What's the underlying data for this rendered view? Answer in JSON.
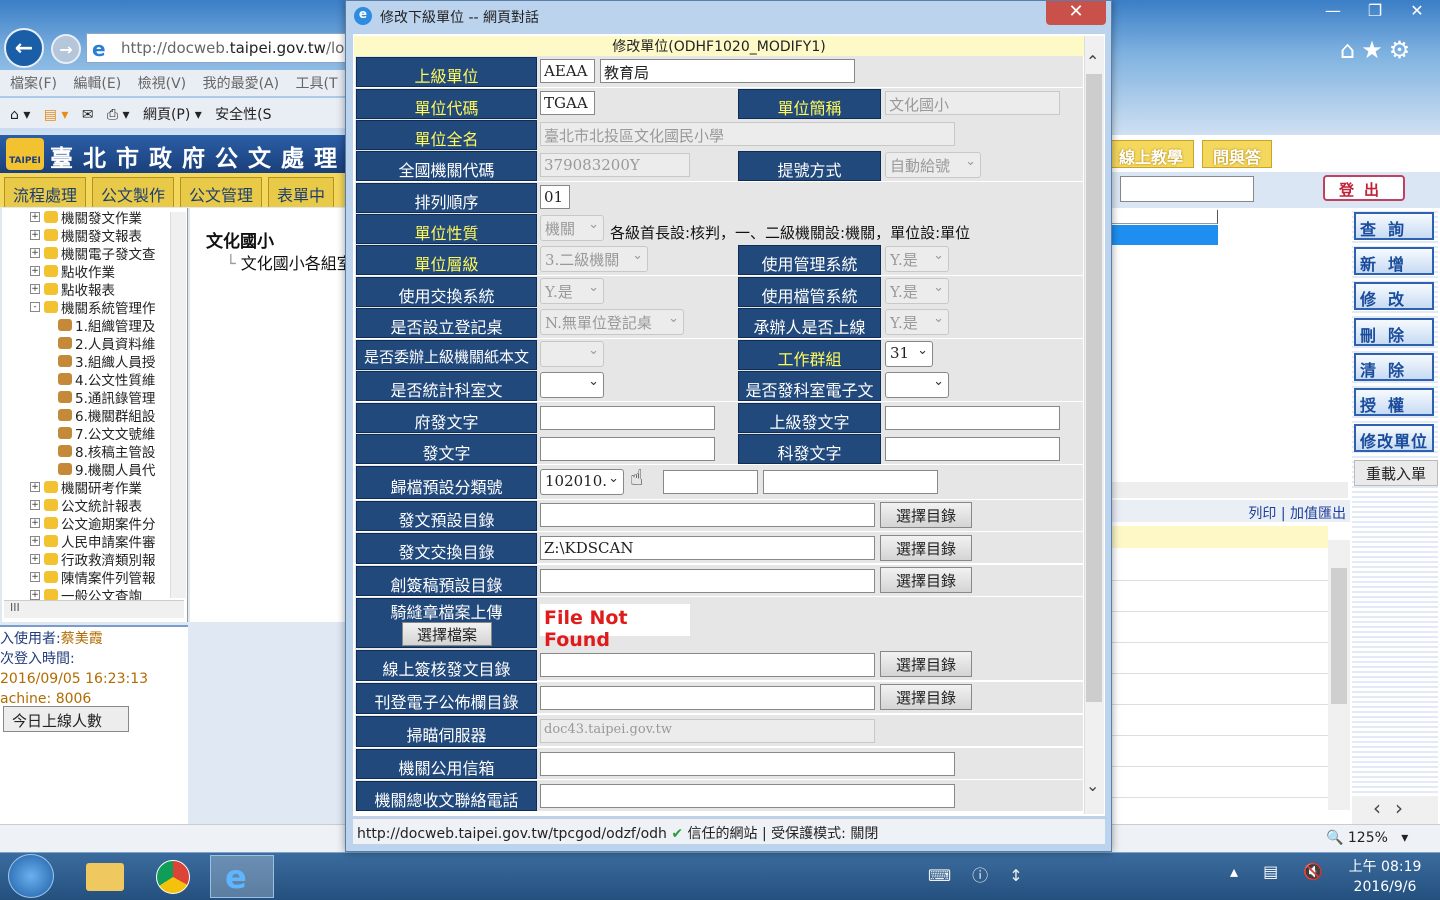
{
  "browser": {
    "url": "http://docweb.taipei.gov.tw/logi",
    "url_prefix": "http://docweb.",
    "url_domain": "taipei.gov.tw",
    "url_suffix": "/logi",
    "menu": "檔案(F) 編輯(E) 檢視(V) 我的最愛(A) 工具(T",
    "cmd_page": "網頁(P)",
    "cmd_security": "安全性(S"
  },
  "left": {
    "header": "臺北市政府公文處理",
    "logo": "TAIPEI",
    "tabs": [
      "流程處理",
      "公文製作",
      "公文管理",
      "表單中"
    ],
    "tree": [
      {
        "label": "機關發文作業",
        "lvl": 0,
        "pm": "+"
      },
      {
        "label": "機關發文報表",
        "lvl": 0,
        "pm": "+"
      },
      {
        "label": "機關電子發文查",
        "lvl": 0,
        "pm": "+"
      },
      {
        "label": "點收作業",
        "lvl": 0,
        "pm": "+"
      },
      {
        "label": "點收報表",
        "lvl": 0,
        "pm": "+"
      },
      {
        "label": "機關系統管理作",
        "lvl": 0,
        "pm": "-"
      },
      {
        "label": "1.組織管理及",
        "lvl": 1,
        "pm": ""
      },
      {
        "label": "2.人員資料維",
        "lvl": 1,
        "pm": ""
      },
      {
        "label": "3.組織人員授",
        "lvl": 1,
        "pm": ""
      },
      {
        "label": "4.公文性質維",
        "lvl": 1,
        "pm": ""
      },
      {
        "label": "5.通訊錄管理",
        "lvl": 1,
        "pm": ""
      },
      {
        "label": "6.機關群組設",
        "lvl": 1,
        "pm": ""
      },
      {
        "label": "7.公文文號維",
        "lvl": 1,
        "pm": ""
      },
      {
        "label": "8.核稿主管設",
        "lvl": 1,
        "pm": ""
      },
      {
        "label": "9.機關人員代",
        "lvl": 1,
        "pm": ""
      },
      {
        "label": "機關研考作業",
        "lvl": 0,
        "pm": "+"
      },
      {
        "label": "公文統計報表",
        "lvl": 0,
        "pm": "+"
      },
      {
        "label": "公文逾期案件分",
        "lvl": 0,
        "pm": "+"
      },
      {
        "label": "人民申請案件審",
        "lvl": 0,
        "pm": "+"
      },
      {
        "label": "行政救濟類別報",
        "lvl": 0,
        "pm": "+"
      },
      {
        "label": "陳情案件列管報",
        "lvl": 0,
        "pm": "+"
      },
      {
        "label": "一般公文查詢",
        "lvl": 0,
        "pm": "+"
      }
    ],
    "hscroll": "III",
    "org_title": "文化國小",
    "org_sub": "文化國小各組室",
    "user_label": "入使用者:",
    "user_name": "蔡美霞",
    "login_label": "次登入時間:",
    "login_time": "2016/09/05 16:23:13",
    "machine": "achine: 8006",
    "online_btn": "今日上線人數"
  },
  "right": {
    "tabs": [
      "線上教學",
      "問與答"
    ],
    "logout": "登出",
    "buttons": [
      "查詢",
      "新增",
      "修改",
      "刪除",
      "清除",
      "授權",
      "修改單位"
    ],
    "reload": "重載入單",
    "print": "列印",
    "export": "加值匯出",
    "zoom": "125%"
  },
  "dialog": {
    "title": "修改下級單位 -- 網頁對話",
    "form_title": "修改單位(ODHF1020_MODIFY1)",
    "labels": {
      "parent": "上級單位",
      "code": "單位代碼",
      "short": "單位簡稱",
      "full": "單位全名",
      "national": "全國機關代碼",
      "numbering": "提號方式",
      "order": "排列順序",
      "nature": "單位性質",
      "level": "單位層級",
      "use_mgmt": "使用管理系統",
      "use_exchange": "使用交換系統",
      "use_archive": "使用檔管系統",
      "reg_desk": "是否設立登記桌",
      "handler_upper": "承辦人是否上線",
      "delegate_paper": "是否委辦上級機關紙本文",
      "work_group": "工作群組",
      "stat_section": "是否統計科室文",
      "send_section_e": "是否發科室電子文",
      "gov_send": "府發文字",
      "upper_send": "上級發文字",
      "send": "發文字",
      "section_send": "科發文字",
      "archive_class": "歸檔預設分類號",
      "send_dir": "發文預設目錄",
      "exchange_dir": "發文交換目錄",
      "draft_dir": "創簽稿預設目錄",
      "seal_upload": "騎縫章檔案上傳",
      "online_sign_dir": "線上簽核發文目錄",
      "bulletin_dir": "刊登電子公佈欄目錄",
      "scan_server": "掃瞄伺服器",
      "mailbox": "機關公用信箱",
      "phone": "機關總收文聯絡電話"
    },
    "values": {
      "parent_code": "AEAA",
      "parent_name": "教育局",
      "code": "TGAA",
      "short": "文化國小",
      "full": "臺北市北投區文化國民小學",
      "national": "379083200Y",
      "numbering": "自動給號",
      "order": "01",
      "nature": "機關",
      "nature_note": "各級首長設:核判，一、二級機關設:機關，單位設:單位",
      "level": "3.二級機關",
      "use_mgmt": "Y.是",
      "use_exchange": "Y.是",
      "use_archive": "Y.是",
      "reg_desk": "N.無單位登記桌",
      "handler_upper": "Y.是",
      "work_group": "31",
      "archive_class": "102010.",
      "exchange_dir": "Z:\\KDSCAN",
      "scan_server": "doc43.taipei.gov.tw"
    },
    "select_dir_btn": "選擇目錄",
    "select_file_btn": "選擇檔案",
    "file_not_found": "File Not Found",
    "status_url": "http://docweb.taipei.gov.tw/tpcgod/odzf/odh",
    "status_trust": "信任的網站 | 受保護模式: 關閉"
  },
  "taskbar": {
    "time": "上午 08:19",
    "date": "2016/9/6"
  }
}
